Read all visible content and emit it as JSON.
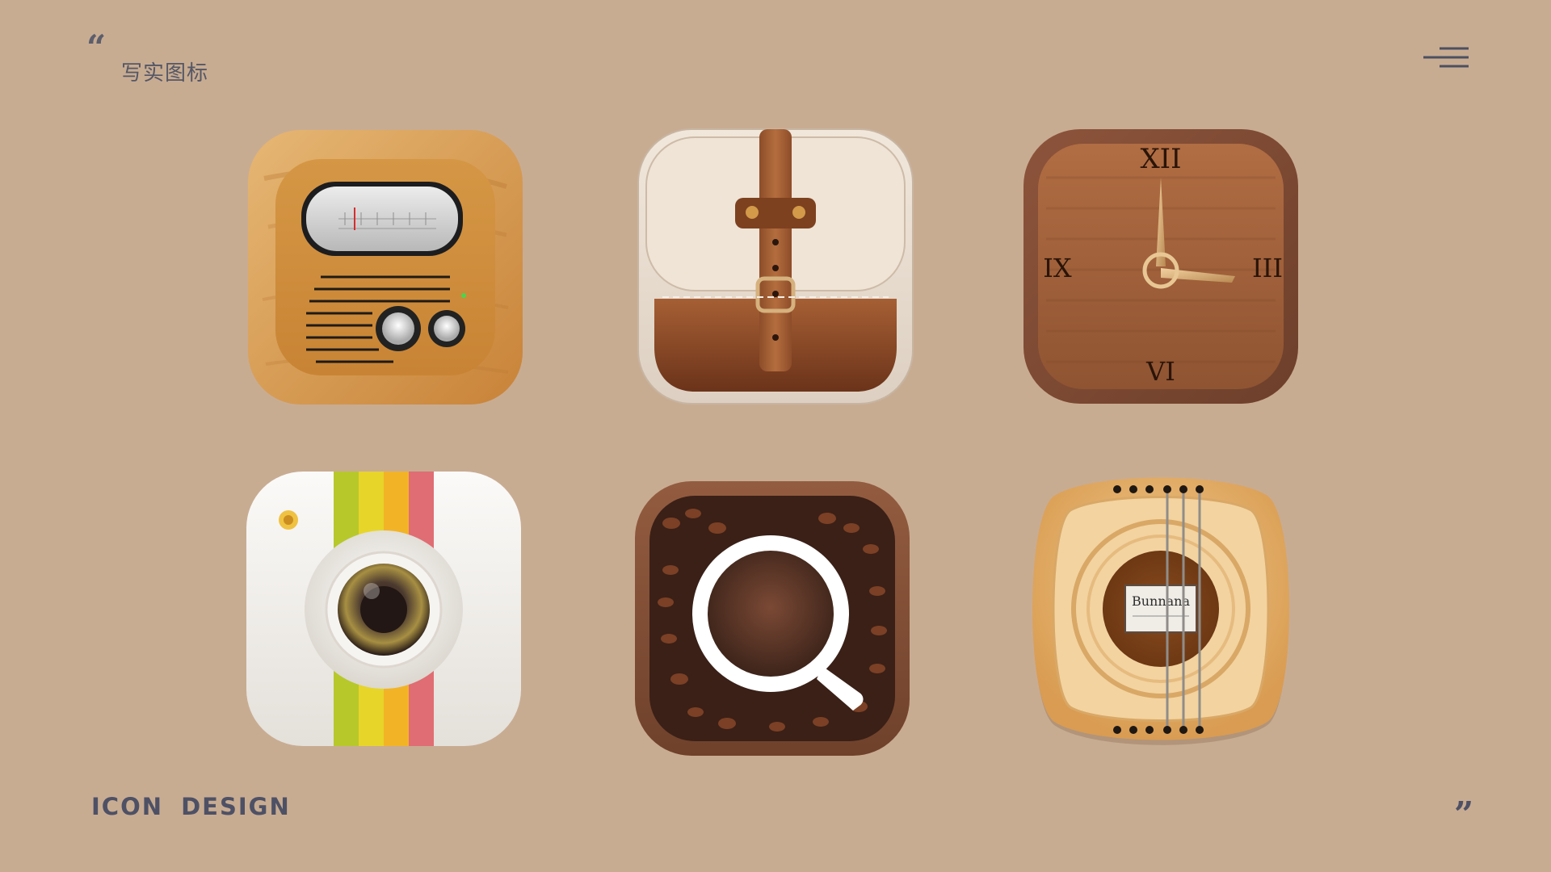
{
  "header": {
    "title": "写实图标",
    "quote_open": "“",
    "menu_icon": "hamburger-menu-icon"
  },
  "footer": {
    "title": "ICON  DESIGN",
    "quote_close": "”"
  },
  "icons": [
    {
      "name": "radio-icon",
      "style": "wood"
    },
    {
      "name": "bag-icon",
      "style": "linen-leather"
    },
    {
      "name": "clock-icon",
      "style": "wood",
      "numerals": {
        "top": "XII",
        "right": "III",
        "bottom": "VI",
        "left": "IX"
      }
    },
    {
      "name": "camera-icon",
      "style": "white-rainbow-stripe"
    },
    {
      "name": "coffee-icon",
      "style": "coffee-beans"
    },
    {
      "name": "guitar-icon",
      "style": "wood",
      "label_text": "Bunnana"
    }
  ],
  "colors": {
    "background": "#c8ac92",
    "heading": "#555766"
  }
}
